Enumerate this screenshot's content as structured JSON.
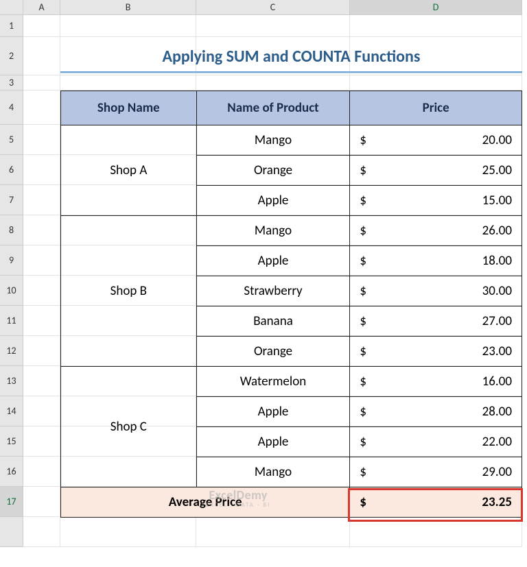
{
  "columns": [
    "A",
    "B",
    "C",
    "D"
  ],
  "row_numbers": [
    "1",
    "2",
    "3",
    "4",
    "5",
    "6",
    "7",
    "8",
    "9",
    "10",
    "11",
    "12",
    "13",
    "14",
    "15",
    "16",
    "17"
  ],
  "selected_column": "D",
  "selected_row": "17",
  "title": "Applying SUM and COUNTA Functions",
  "headers": {
    "shop": "Shop Name",
    "product": "Name of Product",
    "price": "Price"
  },
  "currency": "$",
  "rows": [
    {
      "shop": "Shop A",
      "product": "Mango",
      "price": "20.00"
    },
    {
      "shop": "Shop A",
      "product": "Orange",
      "price": "25.00"
    },
    {
      "shop": "Shop A",
      "product": "Apple",
      "price": "15.00"
    },
    {
      "shop": "Shop B",
      "product": "Mango",
      "price": "26.00"
    },
    {
      "shop": "Shop B",
      "product": "Apple",
      "price": "18.00"
    },
    {
      "shop": "Shop B",
      "product": "Strawberry",
      "price": "30.00"
    },
    {
      "shop": "Shop B",
      "product": "Banana",
      "price": "27.00"
    },
    {
      "shop": "Shop B",
      "product": "Orange",
      "price": "23.00"
    },
    {
      "shop": "Shop C",
      "product": "Watermelon",
      "price": "16.00"
    },
    {
      "shop": "Shop C",
      "product": "Apple",
      "price": "28.00"
    },
    {
      "shop": "Shop C",
      "product": "Apple",
      "price": "22.00"
    },
    {
      "shop": "Shop C",
      "product": "Mango",
      "price": "29.00"
    }
  ],
  "shop_groups": [
    {
      "name": "Shop A",
      "span": 3
    },
    {
      "name": "Shop B",
      "span": 5
    },
    {
      "name": "Shop C",
      "span": 4
    }
  ],
  "summary": {
    "label": "Average Price",
    "value": "23.25"
  },
  "watermark": {
    "line1": "ExcelDemy",
    "line2": "EXCEL · DATA · BI"
  },
  "chart_data": {
    "type": "table",
    "title": "Applying SUM and COUNTA Functions",
    "columns": [
      "Shop Name",
      "Name of Product",
      "Price"
    ],
    "data": [
      [
        "Shop A",
        "Mango",
        20.0
      ],
      [
        "Shop A",
        "Orange",
        25.0
      ],
      [
        "Shop A",
        "Apple",
        15.0
      ],
      [
        "Shop B",
        "Mango",
        26.0
      ],
      [
        "Shop B",
        "Apple",
        18.0
      ],
      [
        "Shop B",
        "Strawberry",
        30.0
      ],
      [
        "Shop B",
        "Banana",
        27.0
      ],
      [
        "Shop B",
        "Orange",
        23.0
      ],
      [
        "Shop C",
        "Watermelon",
        16.0
      ],
      [
        "Shop C",
        "Apple",
        28.0
      ],
      [
        "Shop C",
        "Apple",
        22.0
      ],
      [
        "Shop C",
        "Mango",
        29.0
      ]
    ],
    "summary": {
      "label": "Average Price",
      "value": 23.25
    }
  }
}
